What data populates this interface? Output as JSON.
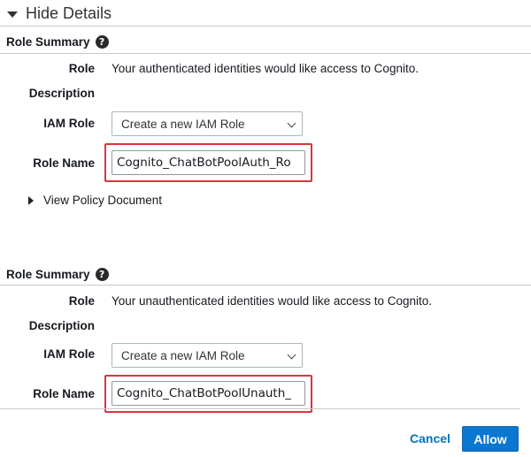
{
  "header": {
    "toggle_label": "Hide Details"
  },
  "auth_section": {
    "title": "Role Summary",
    "role_label": "Role",
    "role_value": "Your authenticated identities would like access to Cognito.",
    "description_label": "Description",
    "iam_role_label": "IAM Role",
    "iam_role_selected": "Create a new IAM Role",
    "role_name_label": "Role Name",
    "role_name_value": "Cognito_ChatBotPoolAuth_Ro",
    "policy_toggle_label": "View Policy Document"
  },
  "unauth_section": {
    "title": "Role Summary",
    "role_label": "Role",
    "role_value": "Your unauthenticated identities would like access to Cognito.",
    "description_label": "Description",
    "iam_role_label": "IAM Role",
    "iam_role_selected": "Create a new IAM Role",
    "role_name_label": "Role Name",
    "role_name_value": "Cognito_ChatBotPoolUnauth_"
  },
  "footer": {
    "cancel_label": "Cancel",
    "allow_label": "Allow"
  },
  "colors": {
    "highlight": "#d9363e",
    "primary": "#0a77d1",
    "link": "#0073bb"
  }
}
